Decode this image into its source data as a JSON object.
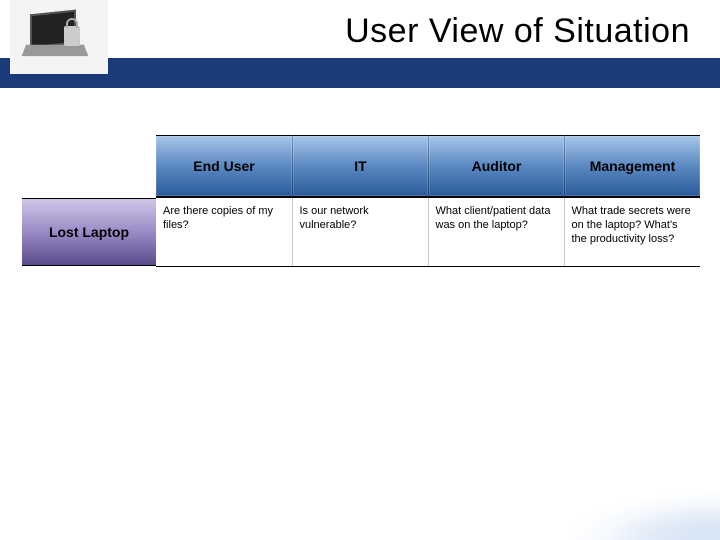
{
  "slide": {
    "title": "User View of Situation"
  },
  "table": {
    "columns": [
      "End User",
      "IT",
      "Auditor",
      "Management"
    ],
    "rows": [
      {
        "label": "Lost Laptop",
        "cells": [
          "Are there copies of my files?",
          "Is our network vulnerable?",
          "What client/patient data was on the laptop?",
          "What trade secrets were on the laptop? What's the productivity loss?"
        ]
      }
    ]
  }
}
